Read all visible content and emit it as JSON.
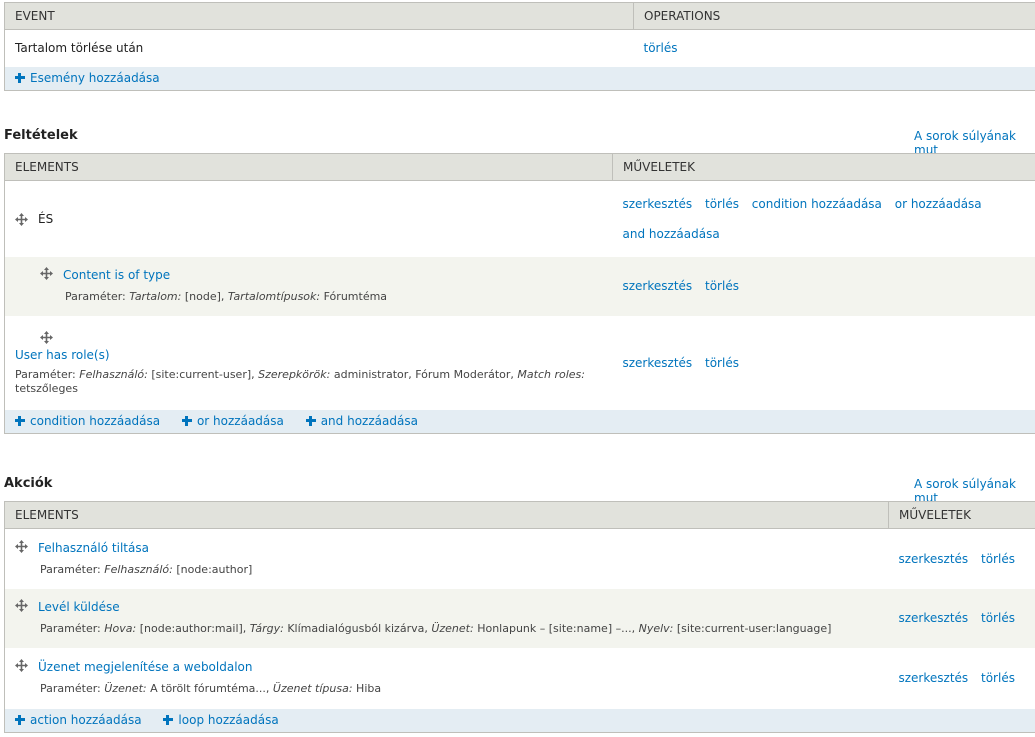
{
  "events": {
    "headers": [
      "EVENT",
      "OPERATIONS"
    ],
    "rows": [
      {
        "label": "Tartalom törlése után",
        "ops": [
          "törlés"
        ]
      }
    ],
    "footer": [
      "Esemény hozzáadása"
    ]
  },
  "conditions": {
    "title": "Feltételek",
    "weights_link": "A sorok súlyának mut",
    "headers": [
      "ELEMENTS",
      "MŰVELETEK"
    ],
    "and_row": {
      "label": "ÉS",
      "ops_line1": [
        "szerkesztés",
        "törlés",
        "condition hozzáadása",
        "or hozzáadása"
      ],
      "ops_line2": [
        "and hozzáadása"
      ]
    },
    "content_type_row": {
      "label": "Content is of type",
      "param_prefix": "Paraméter:",
      "param_k1": "Tartalom:",
      "param_v1": "[node],",
      "param_k2": "Tartalomtípusok:",
      "param_v2": "Fórumtéma",
      "ops": [
        "szerkesztés",
        "törlés"
      ]
    },
    "role_row": {
      "label": "User has role(s)",
      "param_prefix": "Paraméter:",
      "param_k1": "Felhasználó:",
      "param_v1": "[site:current-user],",
      "param_k2": "Szerepkörök:",
      "param_v2": "administrator, Fórum Moderátor,",
      "param_k3": "Match roles:",
      "param_v3": "tetszőleges",
      "ops": [
        "szerkesztés",
        "törlés"
      ]
    },
    "footer": [
      "condition hozzáadása",
      "or hozzáadása",
      "and hozzáadása"
    ]
  },
  "actions": {
    "title": "Akciók",
    "weights_link": "A sorok súlyának mut",
    "headers": [
      "ELEMENTS",
      "MŰVELETEK"
    ],
    "rows": [
      {
        "label": "Felhasználó tiltása",
        "param_prefix": "Paraméter:",
        "p": [
          {
            "k": "Felhasználó:",
            "v": "[node:author]"
          }
        ],
        "ops": [
          "szerkesztés",
          "törlés"
        ]
      },
      {
        "label": "Levél küldése",
        "param_prefix": "Paraméter:",
        "p": [
          {
            "k": "Hova:",
            "v": "[node:author:mail],"
          },
          {
            "k": "Tárgy:",
            "v": "Klímadialógusból kizárva,"
          },
          {
            "k": "Üzenet:",
            "v": "Honlapunk – [site:name] –...,"
          },
          {
            "k": "Nyelv:",
            "v": "[site:current-user:language]"
          }
        ],
        "ops": [
          "szerkesztés",
          "törlés"
        ]
      },
      {
        "label": "Üzenet megjelenítése a weboldalon",
        "param_prefix": "Paraméter:",
        "p": [
          {
            "k": "Üzenet:",
            "v": "A törölt fórumtéma...,"
          },
          {
            "k": "Üzenet típusa:",
            "v": "Hiba"
          }
        ],
        "ops": [
          "szerkesztés",
          "törlés"
        ]
      }
    ],
    "footer": [
      "action hozzáadása",
      "loop hozzáadása"
    ]
  }
}
